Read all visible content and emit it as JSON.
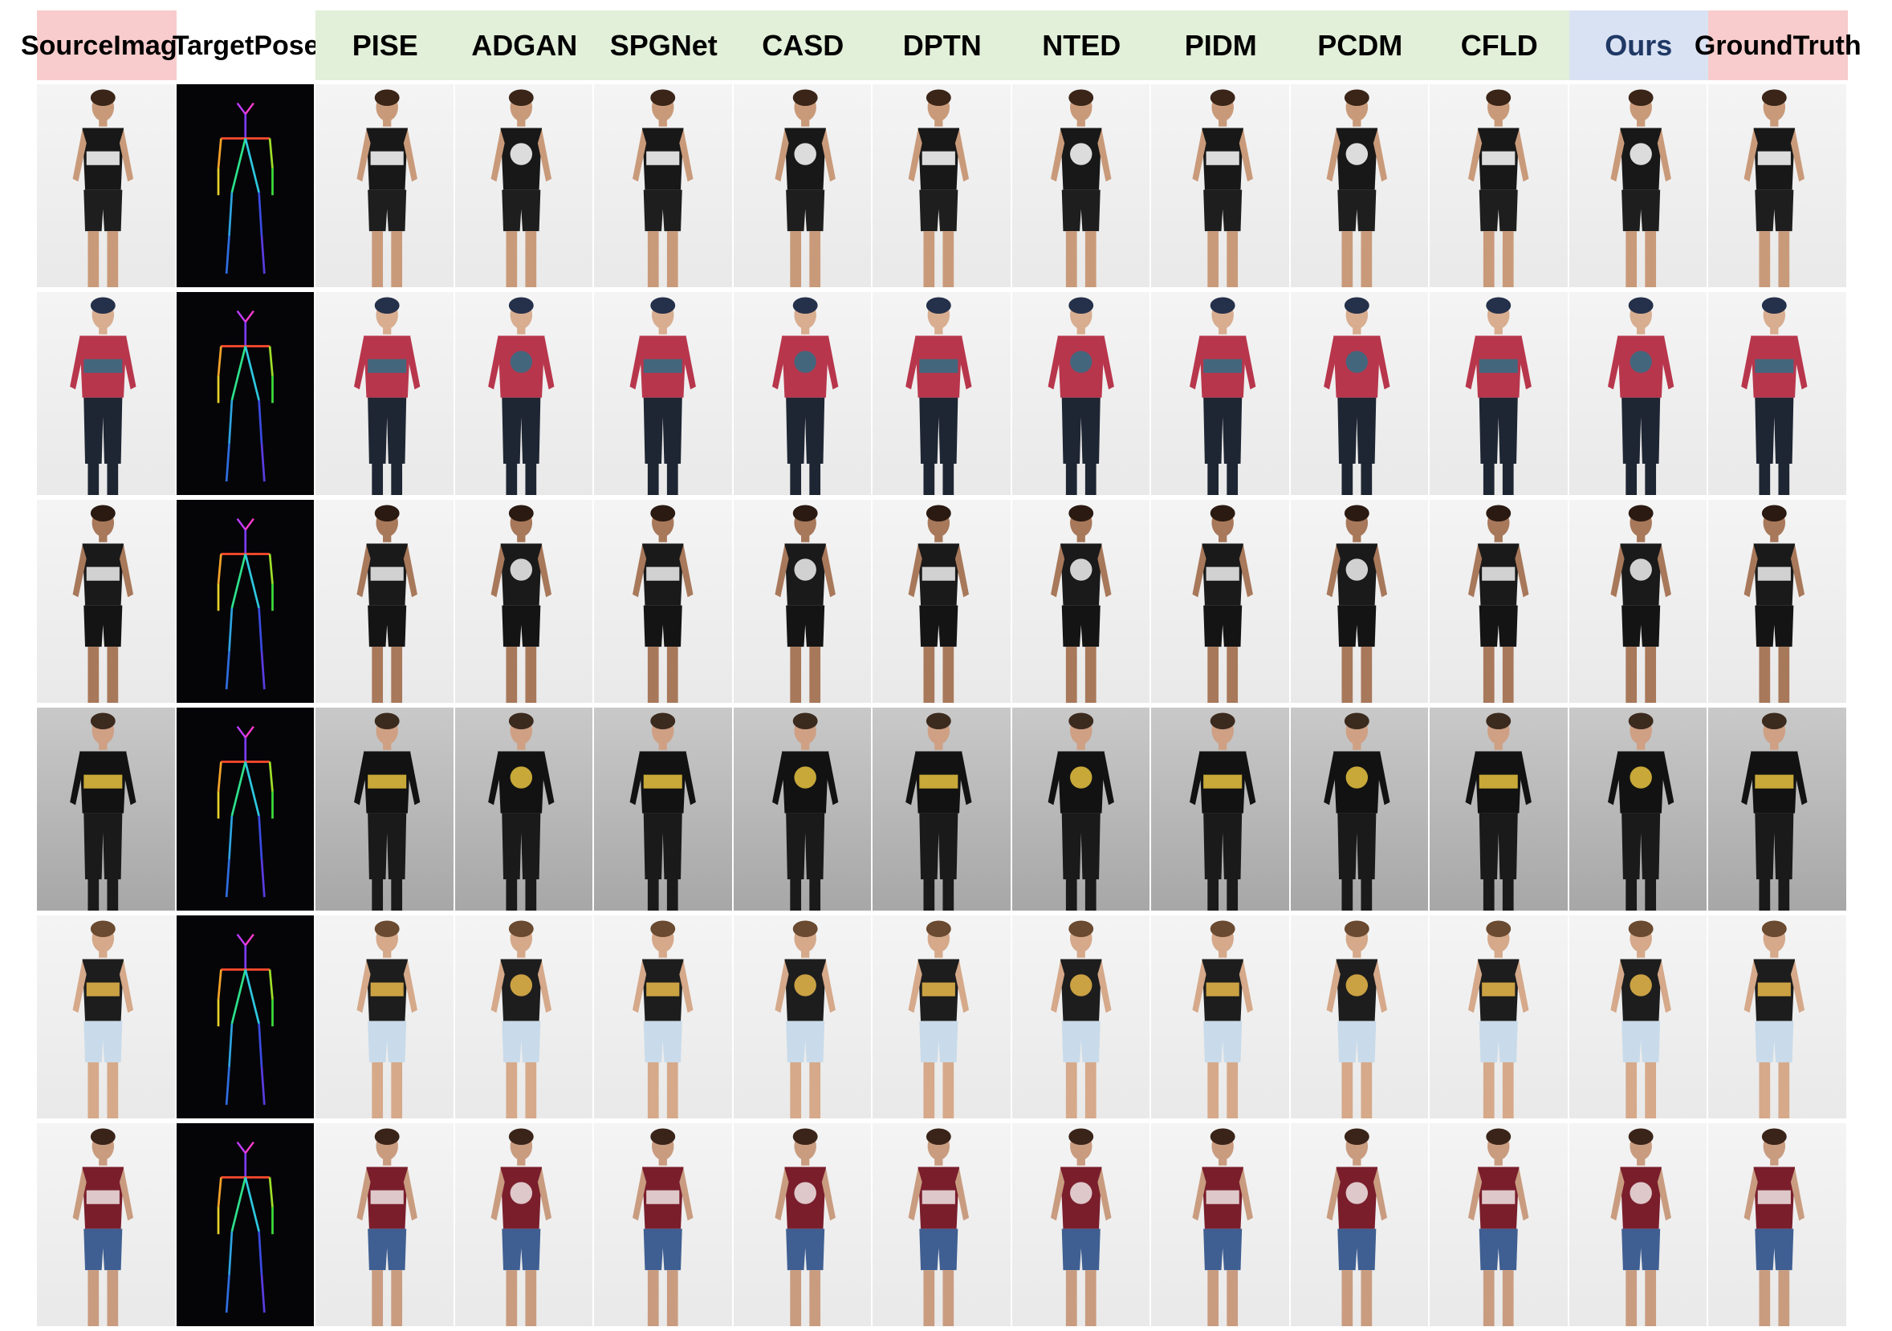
{
  "header": [
    {
      "lines": [
        "Source",
        "Image"
      ],
      "bg": "pink"
    },
    {
      "lines": [
        "Target",
        "Pose"
      ],
      "bg": "white"
    },
    {
      "lines": [
        "PISE"
      ],
      "bg": "green"
    },
    {
      "lines": [
        "ADGAN"
      ],
      "bg": "green"
    },
    {
      "lines": [
        "SPGNet"
      ],
      "bg": "green"
    },
    {
      "lines": [
        "CASD"
      ],
      "bg": "green"
    },
    {
      "lines": [
        "DPTN"
      ],
      "bg": "green"
    },
    {
      "lines": [
        "NTED"
      ],
      "bg": "green"
    },
    {
      "lines": [
        "PIDM"
      ],
      "bg": "green"
    },
    {
      "lines": [
        "PCDM"
      ],
      "bg": "green"
    },
    {
      "lines": [
        "CFLD"
      ],
      "bg": "green"
    },
    {
      "lines": [
        "Ours"
      ],
      "bg": "blue"
    },
    {
      "lines": [
        "Ground",
        "Truth"
      ],
      "bg": "pink"
    }
  ],
  "colors": {
    "pink": "#f8cccc",
    "green": "#e2efd9",
    "blue": "#d9e2f3",
    "ours_text": "#1f3864"
  },
  "rows": [
    {
      "subject": "woman",
      "background": "white",
      "top": "#181818",
      "accent": "#ffffff",
      "bottom": "#1e1e1e",
      "skin": "#c99a7a",
      "hair": "#3a2518"
    },
    {
      "subject": "man",
      "background": "white",
      "top": "#b8364c",
      "accent": "#2f6f86",
      "bottom": "#1f2633",
      "skin": "#d8ad90",
      "hair": "#25304a"
    },
    {
      "subject": "woman",
      "background": "white",
      "top": "#1a1a1a",
      "accent": "#f2f2f2",
      "bottom": "#141414",
      "skin": "#a8785a",
      "hair": "#2a1a12"
    },
    {
      "subject": "man",
      "background": "grey",
      "top": "#121212",
      "accent": "#e8c340",
      "bottom": "#1a1a1a",
      "skin": "#cfa084",
      "hair": "#3b2a1e"
    },
    {
      "subject": "woman",
      "background": "white",
      "top": "#1d1d1d",
      "accent": "#e9b94a",
      "bottom": "#c9dbea",
      "skin": "#d5a98a",
      "hair": "#6a4a30"
    },
    {
      "subject": "woman",
      "background": "white",
      "top": "#7a1e2c",
      "accent": "#f0e6e6",
      "bottom": "#3f5f92",
      "skin": "#c99c80",
      "hair": "#3a2419"
    }
  ],
  "icons": {
    "pose": "skeleton-pose-icon",
    "person": "person-figure-icon"
  }
}
